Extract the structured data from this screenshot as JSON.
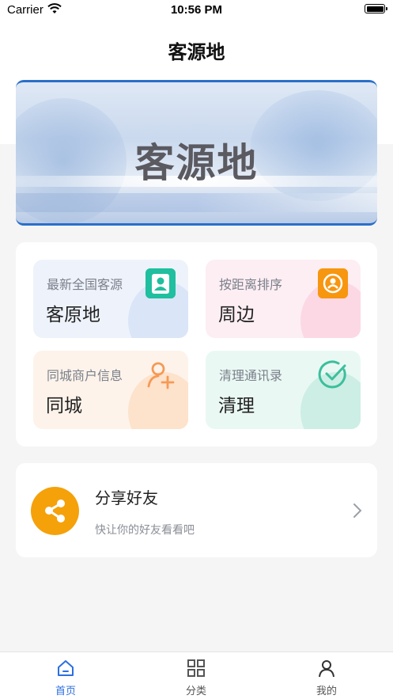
{
  "status_bar": {
    "carrier": "Carrier",
    "time": "10:56 PM"
  },
  "nav": {
    "title": "客源地"
  },
  "banner": {
    "text": "客源地"
  },
  "features": [
    {
      "subtitle": "最新全国客源",
      "title": "客原地",
      "icon": "contact-card-icon"
    },
    {
      "subtitle": "按距离排序",
      "title": "周边",
      "icon": "nearby-user-icon"
    },
    {
      "subtitle": "同城商户信息",
      "title": "同城",
      "icon": "add-user-icon"
    },
    {
      "subtitle": "清理通讯录",
      "title": "清理",
      "icon": "check-circle-icon"
    }
  ],
  "share": {
    "title": "分享好友",
    "subtitle": "快让你的好友看看吧",
    "icon": "share-icon"
  },
  "tabs": [
    {
      "label": "首页",
      "icon": "home-icon",
      "active": true
    },
    {
      "label": "分类",
      "icon": "grid-icon",
      "active": false
    },
    {
      "label": "我的",
      "icon": "person-icon",
      "active": false
    }
  ],
  "colors": {
    "accent": "#2c6fe0",
    "share_orange": "#f5a10a",
    "tile_teal": "#16a98e",
    "tile_orange": "#f5890c"
  }
}
